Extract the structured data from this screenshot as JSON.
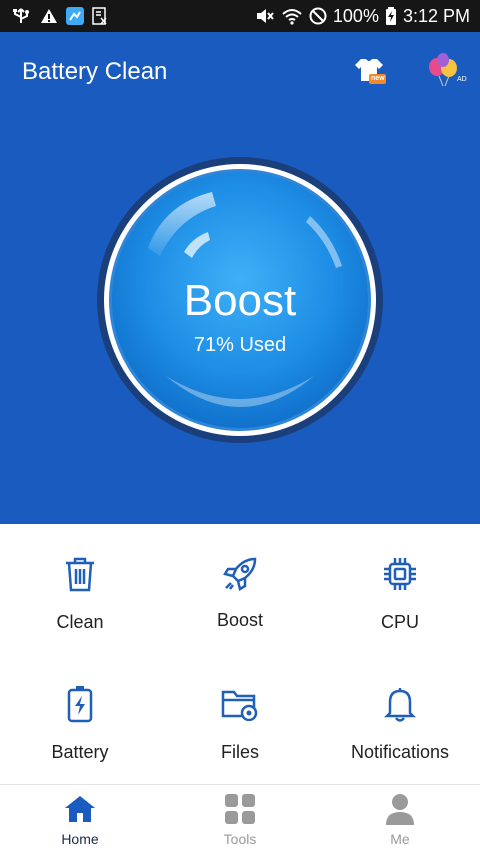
{
  "status_bar": {
    "battery_percent": "100%",
    "time": "3:12 PM",
    "icons": [
      "usb-icon",
      "warning-icon",
      "app-notification-icon",
      "nfc-icon",
      "mute-icon",
      "wifi-icon",
      "do-not-disturb-icon",
      "battery-charging-icon"
    ]
  },
  "header": {
    "title": "Battery Clean",
    "shirt_badge": "new",
    "ad_badge": "AD"
  },
  "boost": {
    "label": "Boost",
    "usage_text": "71% Used",
    "used_fraction": 0.71
  },
  "tools": [
    {
      "label": "Clean",
      "icon": "trash-icon"
    },
    {
      "label": "Boost",
      "icon": "rocket-icon"
    },
    {
      "label": "CPU",
      "icon": "cpu-chip-icon"
    },
    {
      "label": "Battery",
      "icon": "battery-icon"
    },
    {
      "label": "Files",
      "icon": "folder-gear-icon"
    },
    {
      "label": "Notifications",
      "icon": "bell-icon"
    }
  ],
  "bottom_nav": [
    {
      "label": "Home",
      "icon": "home-icon",
      "active": true
    },
    {
      "label": "Tools",
      "icon": "grid-icon",
      "active": false
    },
    {
      "label": "Me",
      "icon": "person-icon",
      "active": false
    }
  ],
  "colors": {
    "primary": "#1a5bbf",
    "icon_blue": "#1f5fb8",
    "nav_active": "#1a5bbf",
    "nav_inactive": "#9a9a9a"
  }
}
